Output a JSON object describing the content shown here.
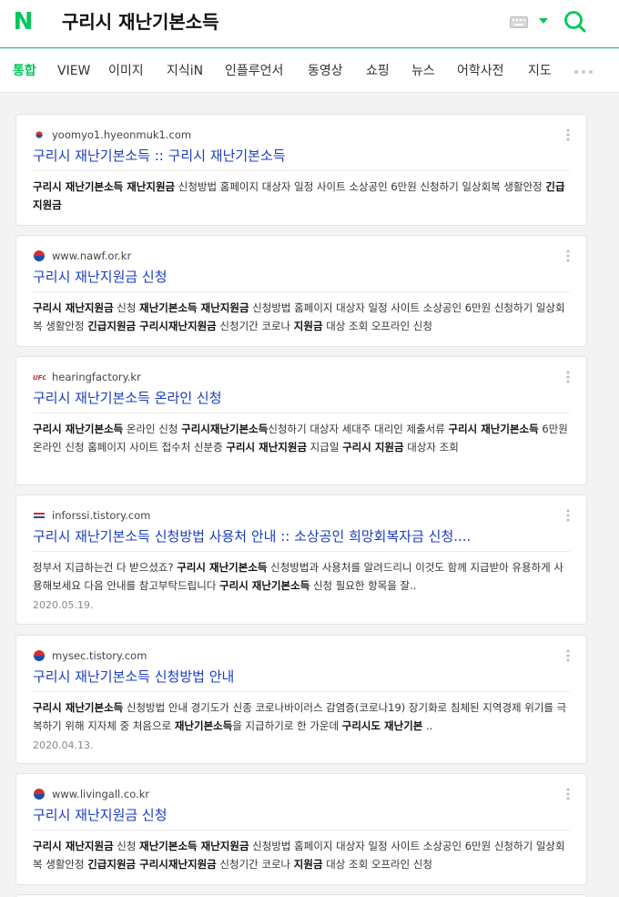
{
  "header": {
    "logo": "N",
    "query": "구리시 재난기본소득"
  },
  "tabs": [
    "통합",
    "VIEW",
    "이미지",
    "지식iN",
    "인플루언서",
    "동영상",
    "쇼핑",
    "뉴스",
    "어학사전",
    "지도"
  ],
  "colors": {
    "brand": "#03c75a",
    "title_link": "#1a3dc1"
  },
  "results": [
    {
      "source": "yoomyo1.hyeonmuk1.com",
      "favicon": "korea-flag-small-icon",
      "title": "구리시 재난기본소득 :: 구리시 재난기본소득",
      "desc_segments": [
        [
          "구리시 재난기본소득 재난지원금",
          true
        ],
        [
          " 신청방법 홈페이지 대상자 일정 사이트 소상공인 6만원 신청하기 일상회복 생활안정 ",
          false
        ],
        [
          "긴급지원금",
          true
        ]
      ]
    },
    {
      "source": "www.nawf.or.kr",
      "favicon": "taegeuk-icon",
      "title": "구리시 재난지원금 신청",
      "desc_segments": [
        [
          "구리시 재난지원금",
          true
        ],
        [
          " 신청 ",
          false
        ],
        [
          "재난기본소득 재난지원금",
          true
        ],
        [
          " 신청방법 홈페이지 대상자 일정 사이트 소상공인 6만원 신청하기 일상회복 생활안정 ",
          false
        ],
        [
          "긴급지원금 구리시재난지원금",
          true
        ],
        [
          " 신청기간 코로나 ",
          false
        ],
        [
          "지원금",
          true
        ],
        [
          " 대상 조회 오프라인 신청",
          false
        ]
      ]
    },
    {
      "source": "hearingfactory.kr",
      "favicon": "ufc-icon",
      "title": "구리시 재난기본소득 온라인 신청",
      "desc_segments": [
        [
          "구리시 재난기본소득",
          true
        ],
        [
          " 온라인 신청 ",
          false
        ],
        [
          "구리시재난기본소득",
          true
        ],
        [
          "신청하기 대상자 세대주 대리인 제출서류 ",
          false
        ],
        [
          "구리시 재난기본소득",
          true
        ],
        [
          " 6만원 온라인 신청 홈페이지 사이트 접수처 신분증 ",
          false
        ],
        [
          "구리시 재난지원금",
          true
        ],
        [
          " 지급일 ",
          false
        ],
        [
          "구리시 지원금",
          true
        ],
        [
          " 대상자 조회",
          false
        ]
      ]
    },
    {
      "source": "inforssi.tistory.com",
      "favicon": "tistory-flag-icon",
      "title": "구리시 재난기본소득 신청방법 사용처 안내 :: 소상공인 희망회복자금 신청....",
      "desc_segments": [
        [
          "정부서 지급하는건 다 받으셨죠? ",
          false
        ],
        [
          "구리시 재난기본소득",
          true
        ],
        [
          " 신청방법과 사용처를 알려드리니 이것도 함께 지급받아 유용하게 사용해보세요 다음 안내를 참고부탁드립니다 ",
          false
        ],
        [
          "구리시 재난기본소득",
          true
        ],
        [
          " 신청 필요한 항목을 잘..",
          false
        ]
      ],
      "date": "2020.05.19."
    },
    {
      "source": "mysec.tistory.com",
      "favicon": "taegeuk-icon",
      "title": "구리시 재난기본소득 신청방법 안내",
      "desc_segments": [
        [
          "구리시 재난기본소득",
          true
        ],
        [
          " 신청방법 안내 경기도가 신종 코로나바이러스 감염증(코로나19) 장기화로 침체된 지역경제 위기를 극복하기 위해 지자체 중 처음으로 ",
          false
        ],
        [
          "재난기본소득",
          true
        ],
        [
          "을 지급하기로 한 가운데 ",
          false
        ],
        [
          "구리시도 재난기본",
          true
        ],
        [
          " ..",
          false
        ]
      ],
      "date": "2020.04.13."
    },
    {
      "source": "www.livingall.co.kr",
      "favicon": "taegeuk-icon",
      "title": "구리시 재난지원금 신청",
      "desc_segments": [
        [
          "구리시 재난지원금",
          true
        ],
        [
          " 신청 ",
          false
        ],
        [
          "재난기본소득 재난지원금",
          true
        ],
        [
          " 신청방법 홈페이지 대상자 일정 사이트 소상공인 6만원 신청하기 일상회복 생활안정 ",
          false
        ],
        [
          "긴급지원금 구리시재난지원금",
          true
        ],
        [
          " 신청기간 코로나 ",
          false
        ],
        [
          "지원금",
          true
        ],
        [
          " 대상 조회 오프라인 신청",
          false
        ]
      ]
    }
  ]
}
